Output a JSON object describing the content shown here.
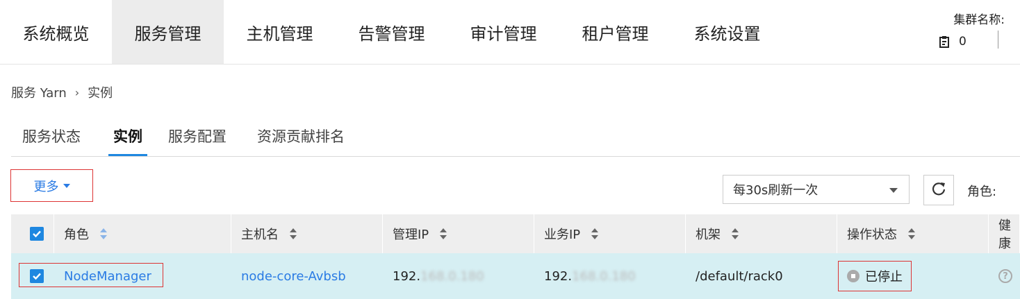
{
  "topnav": {
    "items": [
      "系统概览",
      "服务管理",
      "主机管理",
      "告警管理",
      "审计管理",
      "租户管理",
      "系统设置"
    ],
    "active_index": 1,
    "cluster_label": "集群名称:",
    "task_count": "0"
  },
  "breadcrumb": {
    "service": "服务 Yarn",
    "separator": "›",
    "current": "实例"
  },
  "tabs": [
    "服务状态",
    "实例",
    "服务配置",
    "资源贡献排名"
  ],
  "toolbar": {
    "more_label": "更多",
    "refresh_interval": "每30s刷新一次",
    "role_label": "角色:"
  },
  "table": {
    "headers": [
      "角色",
      "主机名",
      "管理IP",
      "业务IP",
      "机架",
      "操作状态",
      "健康"
    ],
    "rows": [
      {
        "role": "NodeManager",
        "hostname": "node-core-Avbsb",
        "mgmt_ip_prefix": "192.",
        "mgmt_ip_rest": "168.0.180",
        "biz_ip_prefix": "192.",
        "biz_ip_rest": "168.0.180",
        "rack": "/default/rack0",
        "op_status": "已停止",
        "health": "?"
      }
    ]
  },
  "colors": {
    "accent": "#1e87e0",
    "link": "#2a7be4",
    "row_selected": "#d6eff3",
    "highlight_border": "#dd3333"
  }
}
